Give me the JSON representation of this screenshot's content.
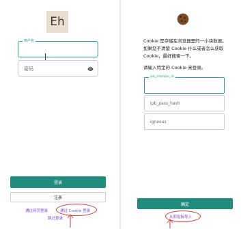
{
  "login_screen": {
    "logo_text": "Eh",
    "username": {
      "label": "用户名",
      "value": ""
    },
    "password": {
      "placeholder": "密码"
    },
    "login_button": "登录",
    "register_button": "注册",
    "web_login_link": "通过网页登录",
    "cookie_login_link": "通过 Cookie 登录",
    "skip_login_link": "跳过登录"
  },
  "cookie_screen": {
    "description": "Cookie 是存储在浏览器里的一小块数据。如果您不清楚 Cookie 什么或者怎么获取 Cookie，最好搜索一下。",
    "instruction": "请输入特定的 Cookie 来登录。",
    "ipb_member_id": {
      "label": "ipb_member_id",
      "value": ""
    },
    "ipb_pass_hash": {
      "placeholder": "ipb_pass_hash"
    },
    "igneous": {
      "placeholder": "igneous"
    },
    "confirm_button": "确定",
    "paste_from_clipboard": "从剪贴板导入"
  },
  "colors": {
    "accent": "#1f8c7c",
    "link": "#7a4bd8",
    "annotation": "#d63a3a"
  }
}
